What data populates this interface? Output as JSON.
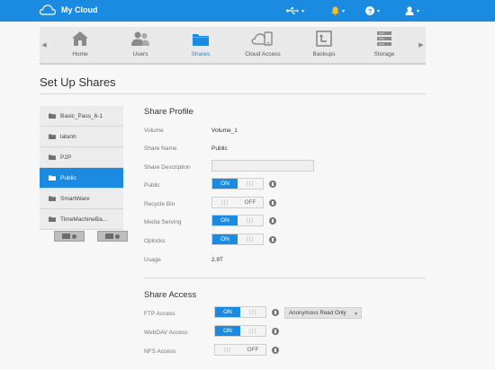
{
  "app": {
    "brand": "My Cloud"
  },
  "topbar": {
    "usb_caret": "▾",
    "alert_caret": "▾",
    "help_caret": "▾",
    "user_caret": "▾"
  },
  "nav": {
    "items": [
      {
        "label": "Home",
        "icon": "home-icon"
      },
      {
        "label": "Users",
        "icon": "users-icon"
      },
      {
        "label": "Shares",
        "icon": "shares-icon",
        "active": true
      },
      {
        "label": "Cloud Access",
        "icon": "cloud-access-icon"
      },
      {
        "label": "Backups",
        "icon": "backups-icon"
      },
      {
        "label": "Storage",
        "icon": "storage-icon"
      }
    ]
  },
  "page": {
    "title": "Set Up Shares"
  },
  "shares": {
    "items": [
      "Basic_Pass_6-1",
      "latanh",
      "P2P",
      "Public",
      "SmartWare",
      "TimeMachineBa..."
    ],
    "selected": "Public"
  },
  "profile": {
    "title": "Share Profile",
    "volume_label": "Volume",
    "volume_value": "Volume_1",
    "name_label": "Share Name",
    "name_value": "Public",
    "desc_label": "Share Description",
    "desc_value": "",
    "public_label": "Public",
    "recycle_label": "Recycle Bin",
    "media_label": "Media Serving",
    "oplocks_label": "Oplocks",
    "usage_label": "Usage",
    "usage_value": "2.9T"
  },
  "access": {
    "title": "Share Access",
    "ftp_label": "FTP Access",
    "webdav_label": "WebDAV Access",
    "nfs_label": "NFS Access",
    "ftp_option": "Anonymous Read Only"
  },
  "toggle": {
    "on": "ON",
    "off": "OFF",
    "grip": "|||"
  },
  "colors": {
    "accent": "#1a8be0"
  }
}
